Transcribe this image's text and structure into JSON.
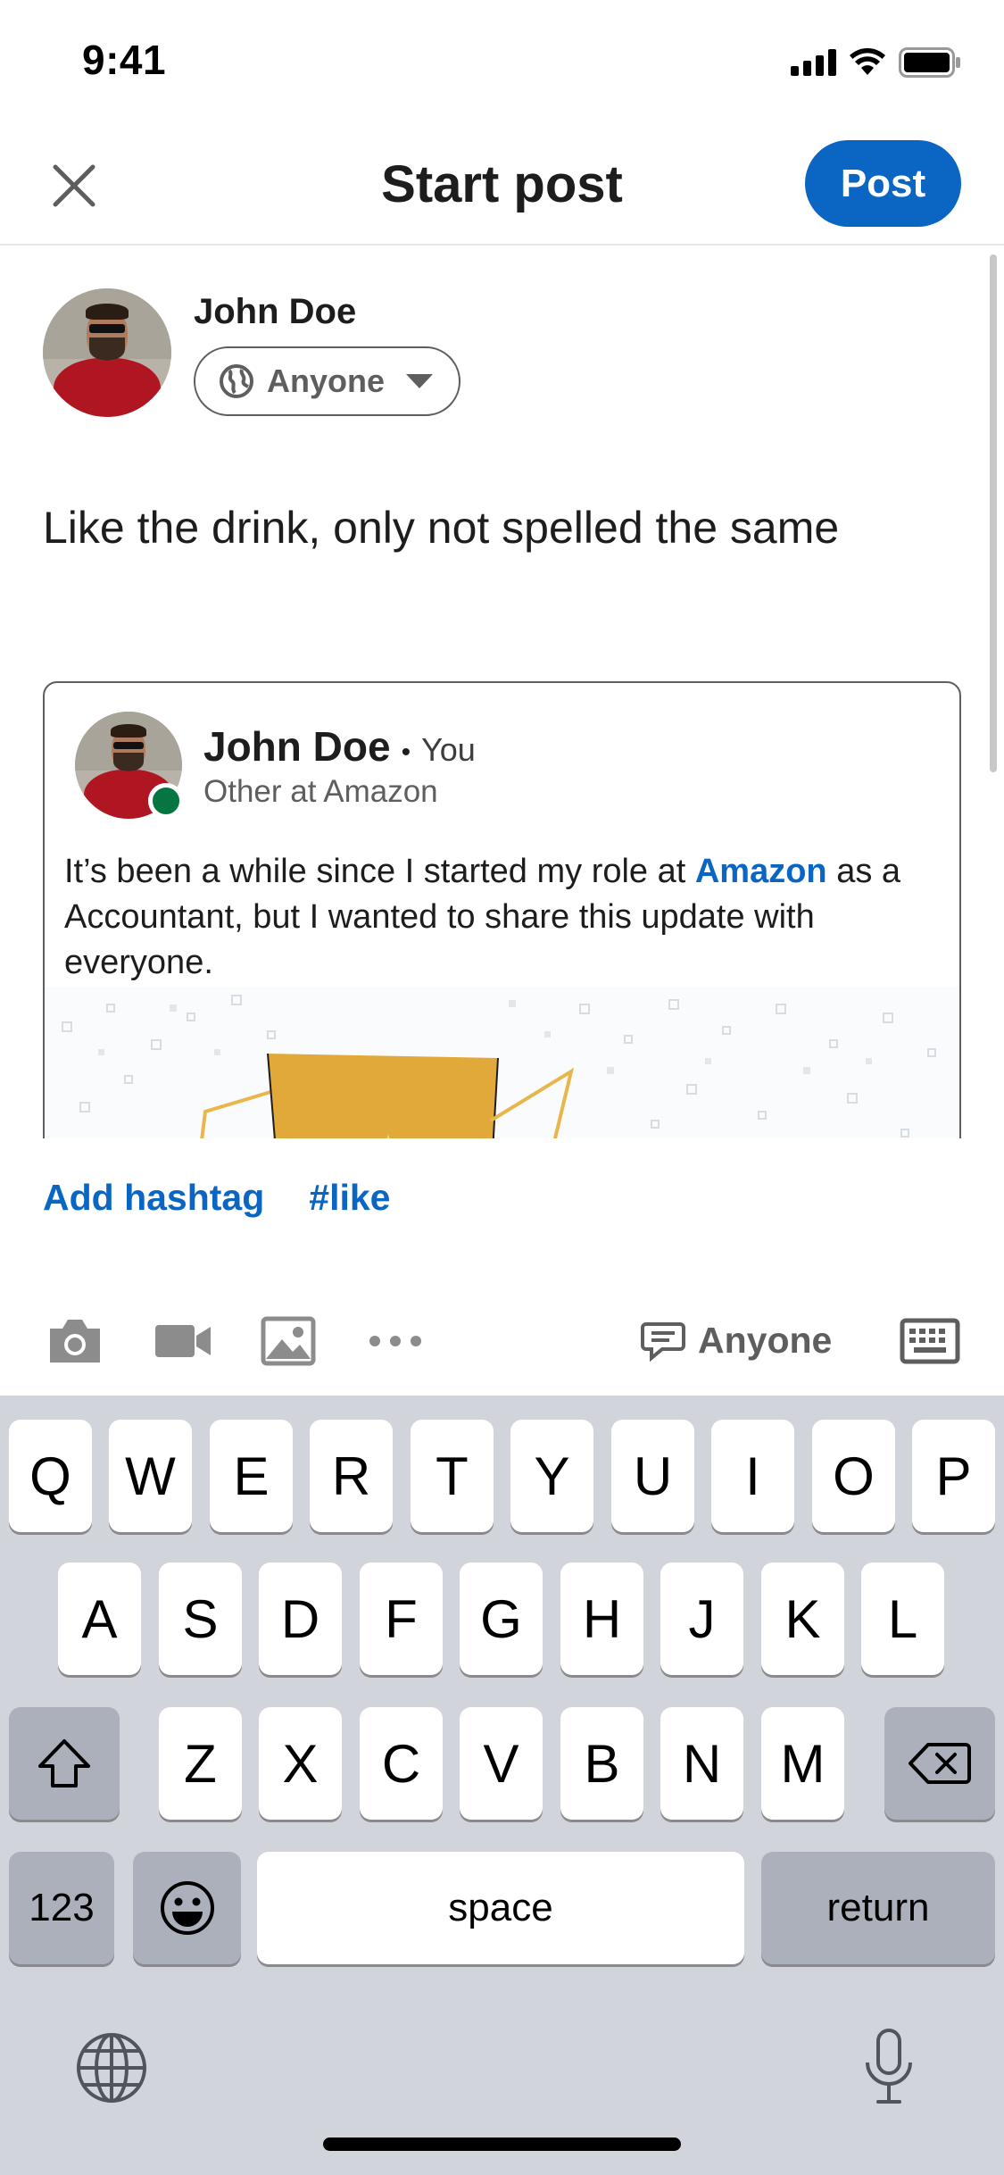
{
  "status_bar": {
    "time": "9:41"
  },
  "header": {
    "title": "Start post",
    "post_label": "Post"
  },
  "author": {
    "name": "John Doe",
    "audience": "Anyone"
  },
  "post": {
    "text": "Like the drink, only not spelled the same"
  },
  "shared_post": {
    "name": "John Doe",
    "separator": "•",
    "relation": "You",
    "headline": "Other at Amazon",
    "body_before": "It’s been a while since I started my role at ",
    "body_link": "Amazon",
    "body_after": " as a Accountant, but I wanted to share this update with everyone."
  },
  "hashtags": {
    "add_label": "Add hashtag",
    "items": [
      "#like"
    ]
  },
  "toolbar": {
    "visibility_label": "Anyone"
  },
  "keyboard": {
    "row1": [
      "Q",
      "W",
      "E",
      "R",
      "T",
      "Y",
      "U",
      "I",
      "O",
      "P"
    ],
    "row2": [
      "A",
      "S",
      "D",
      "F",
      "G",
      "H",
      "J",
      "K",
      "L"
    ],
    "row3": [
      "Z",
      "X",
      "C",
      "V",
      "B",
      "N",
      "M"
    ],
    "numbers_label": "123",
    "space_label": "space",
    "return_label": "return"
  },
  "colors": {
    "accent": "#0a66c2",
    "online": "#057642",
    "keyboard_bg": "#d1d4db"
  },
  "icons": [
    "close-icon",
    "globe-icon",
    "caret-down-icon",
    "camera-icon",
    "video-icon",
    "image-icon",
    "more-icon",
    "comment-icon",
    "keyboard-icon",
    "shift-icon",
    "backspace-icon",
    "emoji-icon",
    "globe-keyboard-icon",
    "microphone-icon"
  ]
}
